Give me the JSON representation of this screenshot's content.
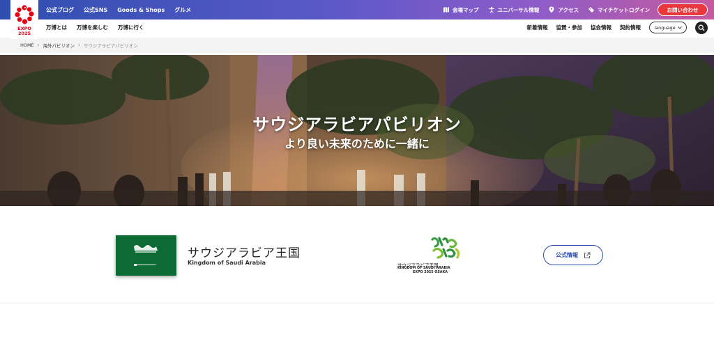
{
  "logo": {
    "text_line1": "EXPO",
    "text_line2": "2025"
  },
  "top_nav": {
    "left_items": [
      "公式ブログ",
      "公式SNS",
      "Goods & Shops",
      "グルメ"
    ],
    "right_items": [
      {
        "icon": "map-icon",
        "label": "会場マップ"
      },
      {
        "icon": "universal-icon",
        "label": "ユニバーサル情報"
      },
      {
        "icon": "location-pin-icon",
        "label": "アクセス"
      },
      {
        "icon": "ticket-icon",
        "label": "マイチケットログイン"
      }
    ],
    "contact_label": "お問い合わせ"
  },
  "sub_nav": {
    "left_items": [
      "万博とは",
      "万博を楽しむ",
      "万博に行く"
    ],
    "right_items": [
      "新着情報",
      "協賛・参加",
      "協会情報",
      "契約情報"
    ],
    "language_label": "language"
  },
  "breadcrumb": {
    "items": [
      "HOME",
      "海外パビリオン"
    ],
    "current": "サウジアラビアパビリオン"
  },
  "hero": {
    "title": "サウジアラビアパビリオン",
    "subtitle": "より良い未来のために一緒に"
  },
  "country": {
    "name_ja": "サウジアラビア王国",
    "name_en": "Kingdom of Saudi Arabia",
    "flag_color": "#0b6b33"
  },
  "pavilion_logo": {
    "name_ja": "サウジアラビア王国",
    "name_en": "KINGDOM OF SAUDI ARABIA",
    "expo_label": "EXPO 2025 OSAKA"
  },
  "official_button": {
    "label": "公式情報",
    "icon": "external-link-icon"
  },
  "colors": {
    "accent_blue": "#2f4fb0",
    "contact_red": "#e8383d",
    "expo_red": "#e60012"
  }
}
